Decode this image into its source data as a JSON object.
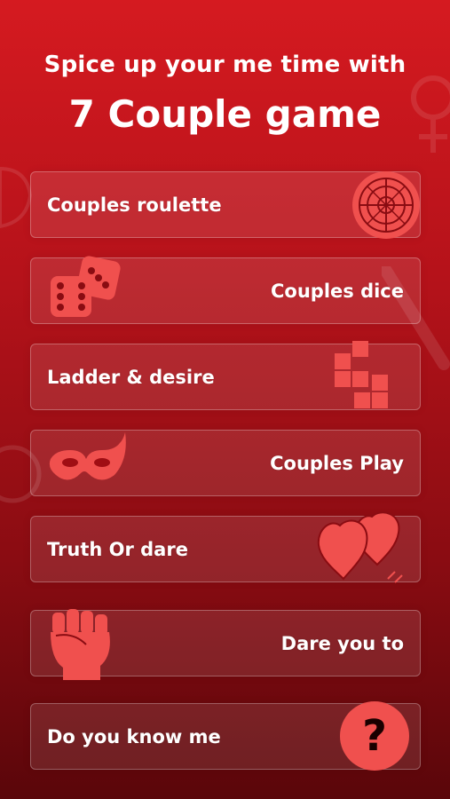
{
  "header": {
    "line1": "Spice up your me time with",
    "line2": "7 Couple game"
  },
  "colors": {
    "accent": "#f0504e",
    "background_top": "#d51a20",
    "background_bottom": "#5a060a"
  },
  "games": [
    {
      "label": "Couples roulette",
      "icon": "roulette-icon"
    },
    {
      "label": "Couples dice",
      "icon": "dice-icon"
    },
    {
      "label": "Ladder & desire",
      "icon": "tetromino-blocks-icon"
    },
    {
      "label": "Couples Play",
      "icon": "mask-icon"
    },
    {
      "label": "Truth Or dare",
      "icon": "hearts-icon"
    },
    {
      "label": "Dare you to",
      "icon": "fist-icon"
    },
    {
      "label": "Do you know me",
      "icon": "question-mark-icon"
    }
  ],
  "question_glyph": "?"
}
